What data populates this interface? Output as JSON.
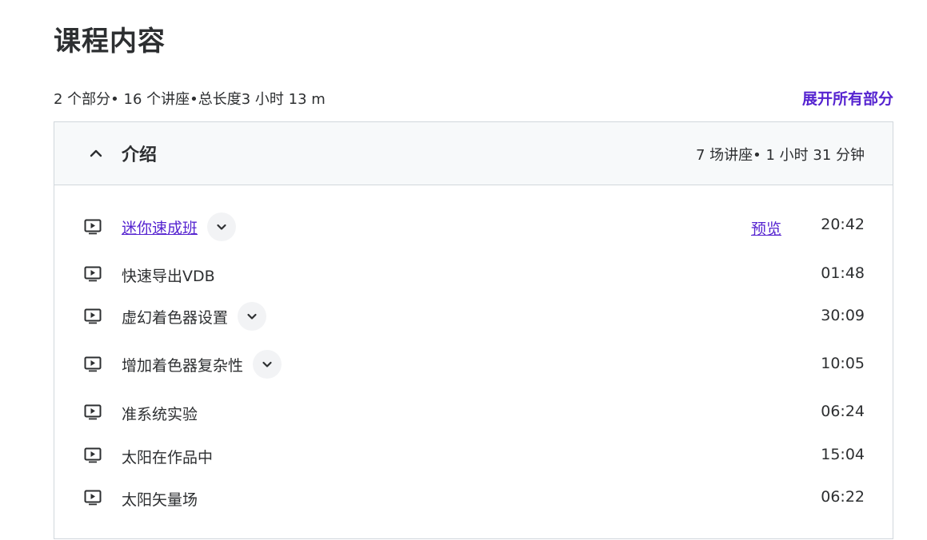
{
  "page_title": "课程内容",
  "summary": "2 个部分• 16 个讲座•总长度3 小时 13 m",
  "expand_all_label": "展开所有部分",
  "accent_color": "#5624d0",
  "section": {
    "title": "介绍",
    "meta": "7 场讲座• 1 小时 31 分钟",
    "expanded": true,
    "lectures": [
      {
        "title": "迷你速成班",
        "is_link": true,
        "has_expand": true,
        "preview_label": "预览",
        "duration": "20:42",
        "icon": "play-video-icon"
      },
      {
        "title": "快速导出VDB",
        "is_link": false,
        "has_expand": false,
        "duration": "01:48",
        "icon": "play-video-icon"
      },
      {
        "title": "虚幻着色器设置",
        "is_link": false,
        "has_expand": true,
        "duration": "30:09",
        "icon": "play-video-icon"
      },
      {
        "title": "增加着色器复杂性",
        "is_link": false,
        "has_expand": true,
        "duration": "10:05",
        "icon": "play-video-icon"
      },
      {
        "title": "准系统实验",
        "is_link": false,
        "has_expand": false,
        "duration": "06:24",
        "icon": "play-video-icon"
      },
      {
        "title": "太阳在作品中",
        "is_link": false,
        "has_expand": false,
        "duration": "15:04",
        "icon": "play-video-icon"
      },
      {
        "title": "太阳矢量场",
        "is_link": false,
        "has_expand": false,
        "duration": "06:22",
        "icon": "play-video-icon"
      }
    ]
  }
}
